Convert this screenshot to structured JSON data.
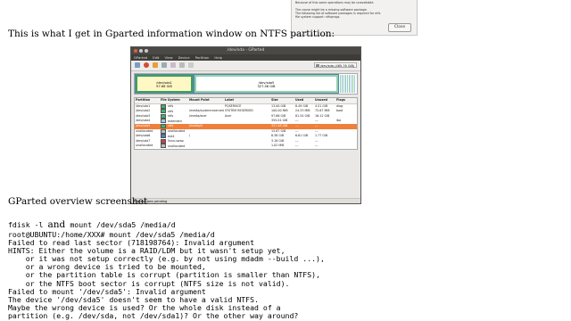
{
  "dialog": {
    "lines": [
      "Because of this some operations may be unavailable.",
      "",
      "The cause might be a missing software package.",
      "The following list of software packages is required for ntfs",
      "file system support: ntfsprogs."
    ],
    "close_label": "Close"
  },
  "intro_text": "This is what I get in Gparted information window on NTFS partition:",
  "gparted": {
    "title": "/dev/sda - GParted",
    "menu": [
      "GParted",
      "Edit",
      "View",
      "Device",
      "Partition",
      "Help"
    ],
    "device_selector": "/dev/sda  (465.76 GiB)",
    "segments": [
      {
        "name": "/dev/sda1",
        "size": "97.66 GiB"
      },
      {
        "name": "/dev/sda5",
        "size": "327.48 GiB"
      }
    ],
    "columns": [
      "Partition",
      "File System",
      "Mount Point",
      "Label",
      "Size",
      "Used",
      "Unused",
      "Flags"
    ],
    "rows": [
      {
        "partition": "/dev/sda1",
        "fs": "ntfs",
        "fs_color": "#42b06a",
        "mount": "",
        "label": "PQSERVICE",
        "size": "13.00 GiB",
        "used": "8.49 GiB",
        "unused": "4.51 GiB",
        "flags": "diag",
        "selected": false
      },
      {
        "partition": "/dev/sda2",
        "fs": "ntfs",
        "fs_color": "#42b06a",
        "mount": "/media/systemreserved",
        "label": "SYSTEM RESERVED",
        "size": "100.00 MiB",
        "used": "24.33 MiB",
        "unused": "75.67 MiB",
        "flags": "boot",
        "selected": false
      },
      {
        "partition": "/dev/sda3",
        "fs": "ntfs",
        "fs_color": "#42b06a",
        "mount": "/media/acer",
        "label": "Acer",
        "size": "97.66 GiB",
        "used": "81.54 GiB",
        "unused": "16.12 GiB",
        "flags": "",
        "selected": false
      },
      {
        "partition": "/dev/sda4",
        "fs": "extended",
        "fs_color": "#a3c4e6",
        "mount": "",
        "label": "",
        "size": "355.01 GiB",
        "used": "---",
        "unused": "---",
        "flags": "lba",
        "selected": false
      },
      {
        "partition": "/dev/sda5",
        "fs": "ntfs",
        "fs_color": "#42b06a",
        "mount": "/media/d",
        "label": "",
        "size": "327.48 GiB",
        "used": "---",
        "unused": "---",
        "flags": "",
        "selected": true
      },
      {
        "partition": "unallocated",
        "fs": "unallocated",
        "fs_color": "#bbbbbb",
        "mount": "",
        "label": "",
        "size": "15.87 GiB",
        "used": "---",
        "unused": "---",
        "flags": "",
        "selected": false
      },
      {
        "partition": "/dev/sda6",
        "fs": "ext4",
        "fs_color": "#4a7fc1",
        "mount": "/",
        "label": "",
        "size": "8.38 GiB",
        "used": "6.61 GiB",
        "unused": "1.77 GiB",
        "flags": "",
        "selected": false
      },
      {
        "partition": "/dev/sda7",
        "fs": "linux-swap",
        "fs_color": "#c84040",
        "mount": "",
        "label": "",
        "size": "3.18 GiB",
        "used": "---",
        "unused": "---",
        "flags": "",
        "selected": false
      },
      {
        "partition": "unallocated",
        "fs": "unallocated",
        "fs_color": "#bbbbbb",
        "mount": "",
        "label": "",
        "size": "1.02 MiB",
        "used": "---",
        "unused": "---",
        "flags": "",
        "selected": false
      }
    ],
    "status": "0 operations pending"
  },
  "overview_caption": "GParted overview screenshot",
  "command_line": {
    "prefix": "fdisk -l",
    "connector": "and",
    "suffix": "mount /dev/sda5 /media/d"
  },
  "terminal_output": "root@UBUNTU:/home/XXX# mount /dev/sda5 /media/d\nFailed to read last sector (718198764): Invalid argument\nHINTS: Either the volume is a RAID/LDM but it wasn't setup yet,\n    or it was not setup correctly (e.g. by not using mdadm --build ...),\n    or a wrong device is tried to be mounted,\n    or the partition table is corrupt (partition is smaller than NTFS),\n    or the NTFS boot sector is corrupt (NTFS size is not valid).\nFailed to mount '/dev/sda5': Invalid argument\nThe device '/dev/sda5' doesn't seem to have a valid NTFS.\nMaybe the wrong device is used? Or the whole disk instead of a\npartition (e.g. /dev/sda, not /dev/sda1)? Or the other way around?"
}
